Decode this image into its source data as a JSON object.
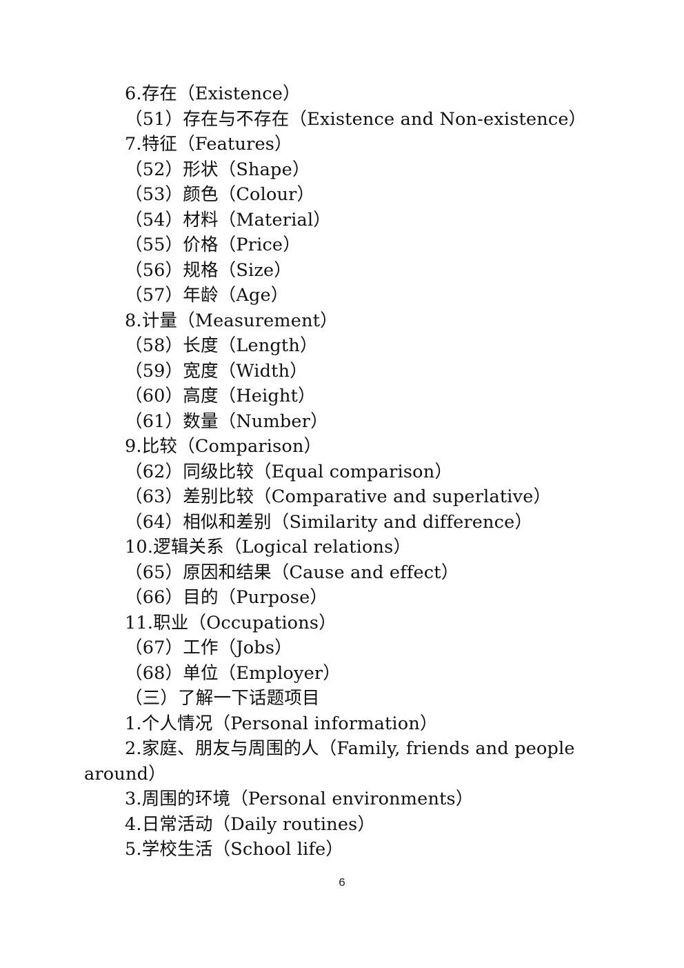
{
  "page": {
    "number": "6",
    "background_color": "#ffffff",
    "text_color": "#111111"
  },
  "document": {
    "lines": [
      {
        "id": "line-06-existence",
        "text": "6.存在（Existence）"
      },
      {
        "id": "line-51-existence-nonexistence",
        "text": "（51）存在与不存在（Existence and Non-existence）"
      },
      {
        "id": "line-07-features",
        "text": "7.特征（Features）"
      },
      {
        "id": "line-52-shape",
        "text": "（52）形状（Shape）"
      },
      {
        "id": "line-53-colour",
        "text": "（53）颜色（Colour）"
      },
      {
        "id": "line-54-material",
        "text": "（54）材料（Material）"
      },
      {
        "id": "line-55-price",
        "text": "（55）价格（Price）"
      },
      {
        "id": "line-56-size",
        "text": "（56）规格（Size）"
      },
      {
        "id": "line-57-age",
        "text": "（57）年龄（Age）"
      },
      {
        "id": "line-08-measurement",
        "text": "8.计量（Measurement）"
      },
      {
        "id": "line-58-length",
        "text": "（58）长度（Length）"
      },
      {
        "id": "line-59-width",
        "text": "（59）宽度（Width）"
      },
      {
        "id": "line-60-height",
        "text": "（60）高度（Height）"
      },
      {
        "id": "line-61-number",
        "text": "（61）数量（Number）"
      },
      {
        "id": "line-09-comparison",
        "text": "9.比较（Comparison）"
      },
      {
        "id": "line-62-equal-comparison",
        "text": "（62）同级比较（Equal comparison）"
      },
      {
        "id": "line-63-comparative-superlative",
        "text": "（63）差别比较（Comparative and superlative）"
      },
      {
        "id": "line-64-similarity-difference",
        "text": "（64）相似和差别（Similarity and difference）"
      },
      {
        "id": "line-10-logical-relations",
        "text": "10.逻辑关系（Logical relations）"
      },
      {
        "id": "line-65-cause-and-effect",
        "text": "（65）原因和结果（Cause and effect）"
      },
      {
        "id": "line-66-purpose",
        "text": "（66）目的（Purpose）"
      },
      {
        "id": "line-11-occupations",
        "text": "11.职业（Occupations）"
      },
      {
        "id": "line-67-jobs",
        "text": "（67）工作（Jobs）"
      },
      {
        "id": "line-68-employer",
        "text": "（68）单位（Employer）"
      },
      {
        "id": "line-section-three-topics",
        "text": "（三）了解一下话题项目"
      },
      {
        "id": "line-01-personal-information",
        "text": "1.个人情况（Personal information）"
      },
      {
        "id": "line-02-family-friends-people",
        "text": "2.家庭、朋友与周围的人（Family, friends and people around）"
      },
      {
        "id": "line-03-personal-environments",
        "text": "3.周围的环境（Personal environments）"
      },
      {
        "id": "line-04-daily-routines",
        "text": "4.日常活动（Daily routines）"
      },
      {
        "id": "line-05-school-life",
        "text": "5.学校生活（School life）"
      }
    ]
  }
}
